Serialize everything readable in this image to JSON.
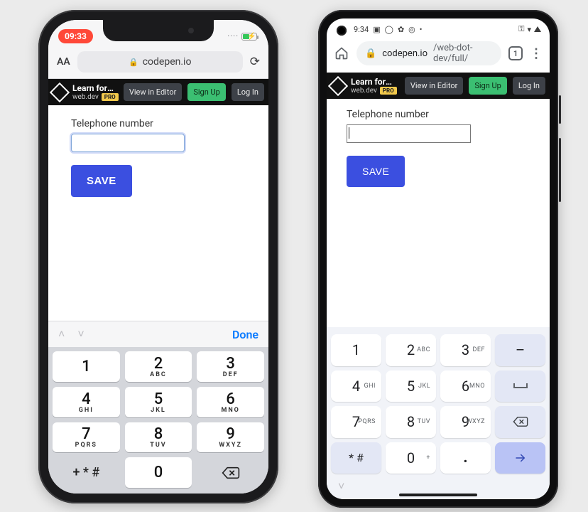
{
  "iphone": {
    "status": {
      "time": "09:33"
    },
    "safari": {
      "url_host": "codepen.io"
    },
    "codepen": {
      "title": "Learn forms – virt…",
      "author": "web.dev",
      "pro": "PRO",
      "view": "View in Editor",
      "signup": "Sign Up",
      "login": "Log In"
    },
    "form": {
      "label": "Telephone number",
      "save": "SAVE"
    },
    "kbbar": {
      "done": "Done"
    },
    "keys": {
      "k1": "1",
      "k2": "2",
      "k2s": "ABC",
      "k3": "3",
      "k3s": "DEF",
      "k4": "4",
      "k4s": "GHI",
      "k5": "5",
      "k5s": "JKL",
      "k6": "6",
      "k6s": "MNO",
      "k7": "7",
      "k7s": "PQRS",
      "k8": "8",
      "k8s": "TUV",
      "k9": "9",
      "k9s": "WXYZ",
      "sym": "+ * #",
      "k0": "0"
    }
  },
  "pixel": {
    "status": {
      "time": "9:34"
    },
    "chrome": {
      "url_host": "codepen.io",
      "url_path": "/web-dot-dev/full/",
      "tabs": "1"
    },
    "codepen": {
      "title": "Learn forms – virt…",
      "author": "web.dev",
      "pro": "PRO",
      "view": "View in Editor",
      "signup": "Sign Up",
      "login": "Log In"
    },
    "form": {
      "label": "Telephone number",
      "save": "SAVE"
    },
    "keys": {
      "k1": "1",
      "k2": "2",
      "k2s": "ABC",
      "k3": "3",
      "k3s": "DEF",
      "dash": "–",
      "k4": "4",
      "k4s": "GHI",
      "k5": "5",
      "k5s": "JKL",
      "k6": "6",
      "k6s": "MNO",
      "space": "⎵",
      "k7": "7",
      "k7s": "PQRS",
      "k8": "8",
      "k8s": "TUV",
      "k9": "9",
      "k9s": "WXYZ",
      "star": "* #",
      "k0": "0",
      "k0s": "+",
      "dot": ".",
      "enter": "→"
    }
  }
}
